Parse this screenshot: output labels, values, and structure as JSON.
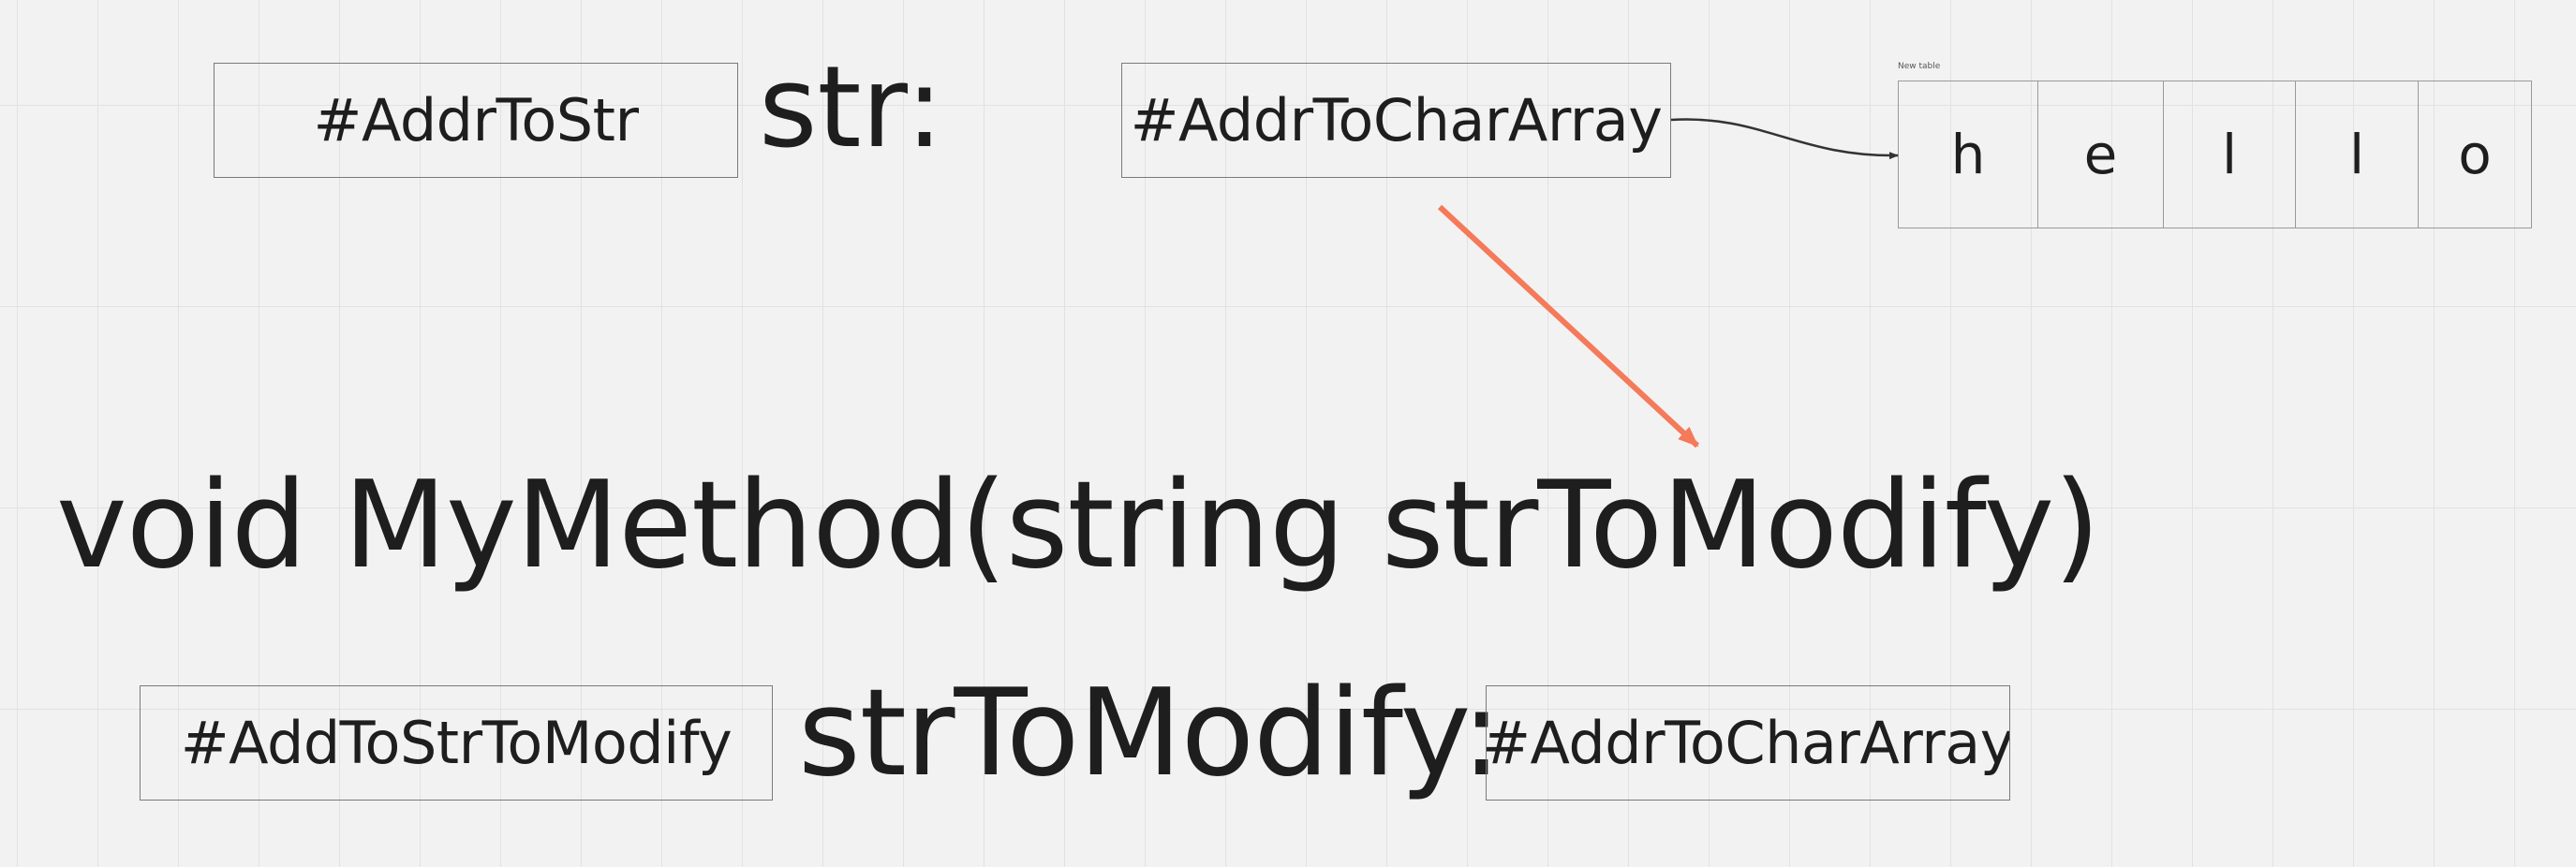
{
  "boxes": {
    "addr_to_str": "#AddrToStr",
    "addr_to_char_array": "#AddrToCharArray",
    "add_to_str_to_modify": "#AddToStrToModify",
    "addr_to_char_array_2": "#AddrToCharArray"
  },
  "labels": {
    "str": "str:",
    "method_signature": "void MyMethod(string strToModify)",
    "str_to_modify": "strToModify:"
  },
  "table": {
    "title": "New table",
    "cells": [
      "h",
      "e",
      "l",
      "l",
      "o"
    ]
  },
  "colors": {
    "pointer_arrow": "#333333",
    "highlight_arrow": "#f47a5a"
  }
}
